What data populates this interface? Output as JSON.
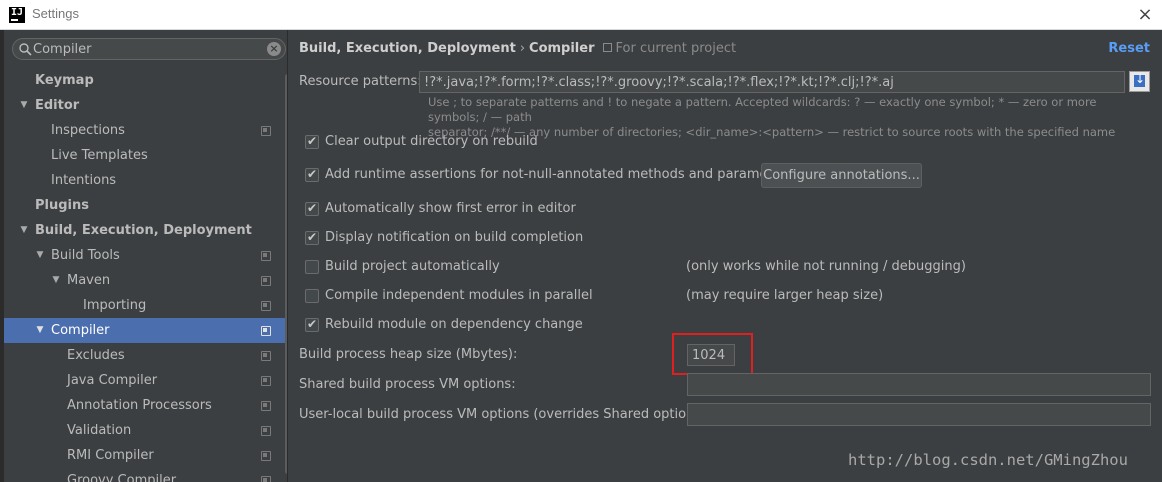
{
  "window": {
    "title": "Settings",
    "app_icon": "intellij-icon",
    "close": "×"
  },
  "search": {
    "value": "Compiler",
    "clear": "×"
  },
  "sidebar": {
    "items": [
      {
        "label": "Keymap",
        "bold": true,
        "level": 0,
        "arrow": "",
        "project": false
      },
      {
        "label": "Editor",
        "bold": true,
        "level": 0,
        "arrow": "▼",
        "project": false
      },
      {
        "label": "Inspections",
        "bold": false,
        "level": 1,
        "arrow": "",
        "project": true
      },
      {
        "label": "Live Templates",
        "bold": false,
        "level": 1,
        "arrow": "",
        "project": false
      },
      {
        "label": "Intentions",
        "bold": false,
        "level": 1,
        "arrow": "",
        "project": false
      },
      {
        "label": "Plugins",
        "bold": true,
        "level": 0,
        "arrow": "",
        "project": false
      },
      {
        "label": "Build, Execution, Deployment",
        "bold": true,
        "level": 0,
        "arrow": "▼",
        "project": false
      },
      {
        "label": "Build Tools",
        "bold": false,
        "level": 1,
        "arrow": "▼",
        "project": true
      },
      {
        "label": "Maven",
        "bold": false,
        "level": 2,
        "arrow": "▼",
        "project": true
      },
      {
        "label": "Importing",
        "bold": false,
        "level": 3,
        "arrow": "",
        "project": true
      },
      {
        "label": "Compiler",
        "bold": false,
        "level": 1,
        "arrow": "▼",
        "project": true,
        "selected": true
      },
      {
        "label": "Excludes",
        "bold": false,
        "level": 2,
        "arrow": "",
        "project": true
      },
      {
        "label": "Java Compiler",
        "bold": false,
        "level": 2,
        "arrow": "",
        "project": true
      },
      {
        "label": "Annotation Processors",
        "bold": false,
        "level": 2,
        "arrow": "",
        "project": true
      },
      {
        "label": "Validation",
        "bold": false,
        "level": 2,
        "arrow": "",
        "project": true
      },
      {
        "label": "RMI Compiler",
        "bold": false,
        "level": 2,
        "arrow": "",
        "project": true
      },
      {
        "label": "Groovy Compiler",
        "bold": false,
        "level": 2,
        "arrow": "",
        "project": true
      }
    ]
  },
  "header": {
    "crumb_parent": "Build, Execution, Deployment",
    "crumb_sep": "›",
    "crumb_current": "Compiler",
    "scope": "For current project",
    "reset": "Reset"
  },
  "resource_patterns": {
    "label": "Resource patterns:",
    "value": "!?*.java;!?*.form;!?*.class;!?*.groovy;!?*.scala;!?*.flex;!?*.kt;!?*.clj;!?*.aj",
    "hint_line1": "Use ; to separate patterns and ! to negate a pattern. Accepted wildcards: ? — exactly one symbol; * — zero or more symbols; / — path",
    "hint_line2": "separator; /**/ — any number of directories; <dir_name>:<pattern> — restrict to source roots with the specified name"
  },
  "options": [
    {
      "label": "Clear output directory on rebuild",
      "checked": true,
      "note": ""
    },
    {
      "label": "Add runtime assertions for not-null-annotated methods and parameters",
      "checked": true,
      "note": ""
    },
    {
      "label": "Automatically show first error in editor",
      "checked": true,
      "note": ""
    },
    {
      "label": "Display notification on build completion",
      "checked": true,
      "note": ""
    },
    {
      "label": "Build project automatically",
      "checked": false,
      "note": "(only works while not running / debugging)"
    },
    {
      "label": "Compile independent modules in parallel",
      "checked": false,
      "note": "(may require larger heap size)"
    },
    {
      "label": "Rebuild module on dependency change",
      "checked": true,
      "note": ""
    }
  ],
  "configure_button": "Configure annotations...",
  "heap": {
    "label": "Build process heap size (Mbytes):",
    "value": "1024"
  },
  "shared_vm": {
    "label": "Shared build process VM options:",
    "value": ""
  },
  "user_vm": {
    "label": "User-local build process VM options (overrides Shared options):",
    "value": ""
  },
  "watermark": "http://blog.csdn.net/GMingZhou",
  "colors": {
    "selection": "#4b6eaf",
    "link": "#589df6",
    "highlight_box": "#e02020",
    "background": "#3c3f41"
  }
}
